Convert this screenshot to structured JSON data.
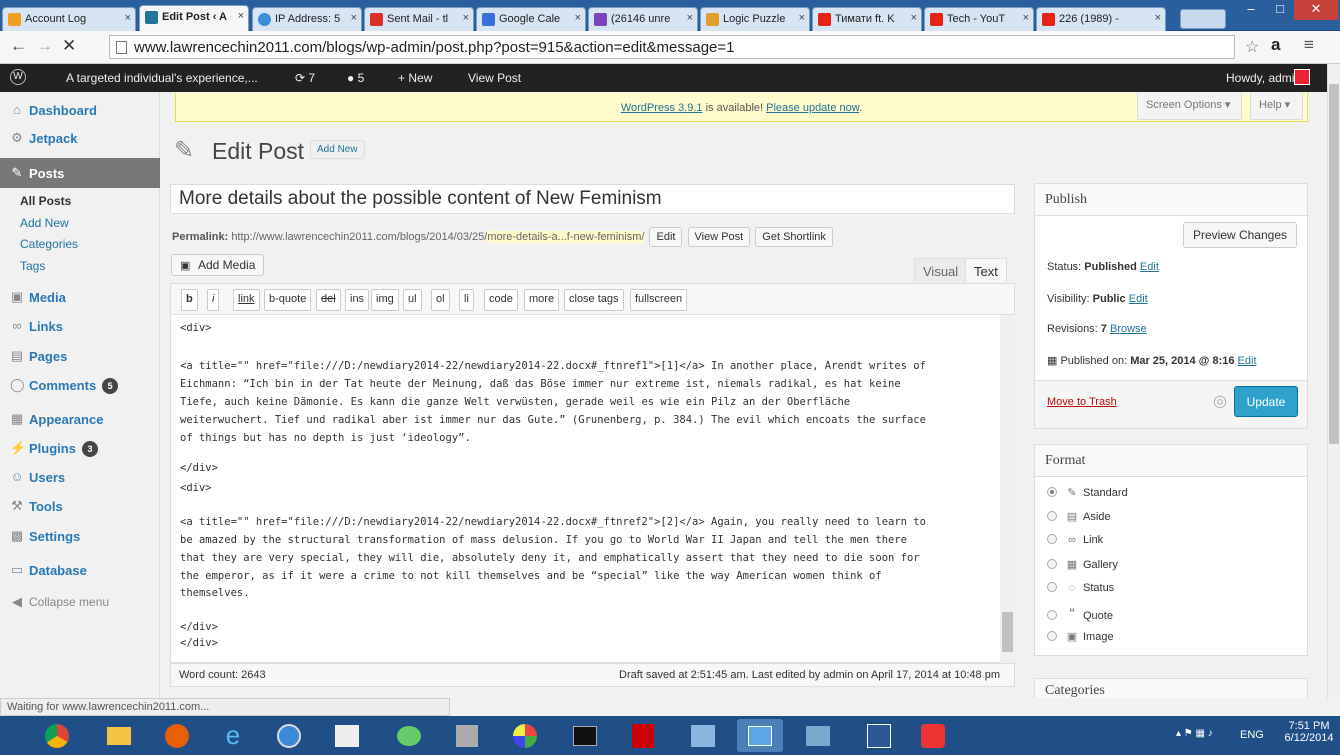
{
  "browser": {
    "tabs": [
      {
        "label": "Account Log",
        "icon": "grid-icon",
        "color": "#f0a020"
      },
      {
        "label": "Edit Post ‹ A",
        "icon": "wordpress-icon",
        "color": "#21759b"
      },
      {
        "label": "IP Address: 5",
        "icon": "globe-icon",
        "color": "#3c8ed8"
      },
      {
        "label": "Sent Mail - tl",
        "icon": "gmail-icon",
        "color": "#d93025"
      },
      {
        "label": "Google Cale",
        "icon": "calendar-icon",
        "color": "#3b6fd8"
      },
      {
        "label": "(26146 unre",
        "icon": "mail-icon",
        "color": "#7a45b8"
      },
      {
        "label": "Logic Puzzle",
        "icon": "puzzle-icon",
        "color": "#e0a030"
      },
      {
        "label": "Тимати ft. K",
        "icon": "youtube-icon",
        "color": "#e62117"
      },
      {
        "label": "Tech - YouT",
        "icon": "youtube-icon",
        "color": "#e62117"
      },
      {
        "label": "226 (1989) -",
        "icon": "youtube-icon",
        "color": "#e62117"
      }
    ],
    "url": "www.lawrencechin2011.com/blogs/wp-admin/post.php?post=915&action=edit&message=1",
    "status": "Waiting for www.lawrencechin2011.com..."
  },
  "adminbar": {
    "site": "A targeted individual's experience,...",
    "updates": "7",
    "comments": "5",
    "new": "New",
    "view_post": "View Post",
    "howdy": "Howdy, admin"
  },
  "sidebar": {
    "items": [
      {
        "label": "Dashboard",
        "icon": "dashboard-icon"
      },
      {
        "label": "Jetpack",
        "icon": "jetpack-icon"
      },
      {
        "label": "Posts",
        "icon": "pin-icon"
      },
      {
        "label": "Media",
        "icon": "media-icon"
      },
      {
        "label": "Links",
        "icon": "link-icon"
      },
      {
        "label": "Pages",
        "icon": "pages-icon"
      },
      {
        "label": "Comments",
        "icon": "comment-icon",
        "badge": "5"
      },
      {
        "label": "Appearance",
        "icon": "appearance-icon"
      },
      {
        "label": "Plugins",
        "icon": "plugin-icon",
        "badge": "3"
      },
      {
        "label": "Users",
        "icon": "users-icon"
      },
      {
        "label": "Tools",
        "icon": "tools-icon"
      },
      {
        "label": "Settings",
        "icon": "settings-icon"
      },
      {
        "label": "Database",
        "icon": "database-icon"
      }
    ],
    "posts_sub": [
      "All Posts",
      "Add New",
      "Categories",
      "Tags"
    ],
    "collapse": "Collapse menu"
  },
  "notice": {
    "version_link": "WordPress 3.9.1",
    "middle": " is available! ",
    "update_link": "Please update now",
    "end": "."
  },
  "screen_options": "Screen Options ▾",
  "help": "Help ▾",
  "page_title": "Edit Post",
  "add_new": "Add New",
  "post_title": "More details about the possible content of New Feminism",
  "permalink": {
    "label": "Permalink:",
    "base": "http://www.lawrencechin2011.com/blogs/2014/03/25/",
    "slug": "more-details-a...f-new-feminism/",
    "edit": "Edit",
    "view": "View Post",
    "shortlink": "Get Shortlink"
  },
  "add_media": "Add Media",
  "editor_tabs": {
    "visual": "Visual",
    "text": "Text"
  },
  "quicktags": [
    "b",
    "i",
    "link",
    "b-quote",
    "del",
    "ins",
    "img",
    "ul",
    "ol",
    "li",
    "code",
    "more",
    "close tags",
    "fullscreen"
  ],
  "content_lines": [
    "<div>",
    "",
    "<a title=\"\" href=\"file:///D:/newdiary2014-22/newdiary2014-22.docx#_ftnref1\">[1]</a> In another place, Arendt writes of",
    "Eichmann: “Ich bin in der Tat heute der Meinung, daß das Böse immer nur extreme ist, niemals radikal, es hat keine",
    "Tiefe, auch keine Dämonie. Es kann die ganze Welt verwüsten, gerade weil es wie ein Pilz an der Oberfläche",
    "weiterwuchert. Tief und radikal aber ist immer nur das Gute.” (Grunenberg, p. 384.) The evil which encoats the surface",
    "of things but has no depth is just ‘ideology”.",
    "",
    "</div>",
    "<div>",
    "",
    "<a title=\"\" href=\"file:///D:/newdiary2014-22/newdiary2014-22.docx#_ftnref2\">[2]</a> Again, you really need to learn to",
    "be amazed by the structural transformation of mass delusion. If you go to World War II Japan and tell the men there",
    "that they are very special, they will die, absolutely deny it, and emphatically assert that they need to die soon for",
    "the emperor, as if it were a crime to not kill themselves and be “special” like the way American women think of",
    "themselves.",
    "",
    "</div>",
    "</div>"
  ],
  "word_count": "Word count: 2643",
  "draft_status": "Draft saved at 2:51:45 am. Last edited by admin on April 17, 2014 at 10:48 pm",
  "publish": {
    "title": "Publish",
    "preview": "Preview Changes",
    "status_label": "Status: ",
    "status_value": "Published",
    "visibility_label": "Visibility: ",
    "visibility_value": "Public",
    "revisions_label": "Revisions: ",
    "revisions_value": "7",
    "browse": "Browse",
    "published_label": "Published on: ",
    "published_value": "Mar 25, 2014 @ 8:16",
    "edit": "Edit",
    "trash": "Move to Trash",
    "update": "Update"
  },
  "format": {
    "title": "Format",
    "options": [
      {
        "label": "Standard",
        "icon": "pin-icon",
        "selected": true
      },
      {
        "label": "Aside",
        "icon": "aside-icon",
        "selected": false
      },
      {
        "label": "Link",
        "icon": "link-icon",
        "selected": false
      },
      {
        "label": "Gallery",
        "icon": "gallery-icon",
        "selected": false
      },
      {
        "label": "Status",
        "icon": "status-icon",
        "selected": false
      },
      {
        "label": "Quote",
        "icon": "quote-icon",
        "selected": false
      },
      {
        "label": "Image",
        "icon": "image-icon",
        "selected": false
      }
    ]
  },
  "categories": {
    "title": "Categories"
  },
  "taskbar": {
    "apps": [
      "chrome-icon",
      "explorer-icon",
      "firefox-icon",
      "ie-icon",
      "media-icon",
      "dictionary-icon",
      "people-icon",
      "tool-icon",
      "paint-icon",
      "cmd-icon",
      "pdf-icon",
      "note-icon",
      "remote-icon",
      "photo-icon",
      "word-icon",
      "app-icon"
    ],
    "lang": "ENG",
    "time": "7:51 PM",
    "date": "6/12/2014"
  },
  "colors": {
    "accent": "#21759b",
    "update": "#2ea2cc",
    "trash": "#bc0b0b",
    "admin_bar": "#222222",
    "current_menu": "#777777"
  }
}
